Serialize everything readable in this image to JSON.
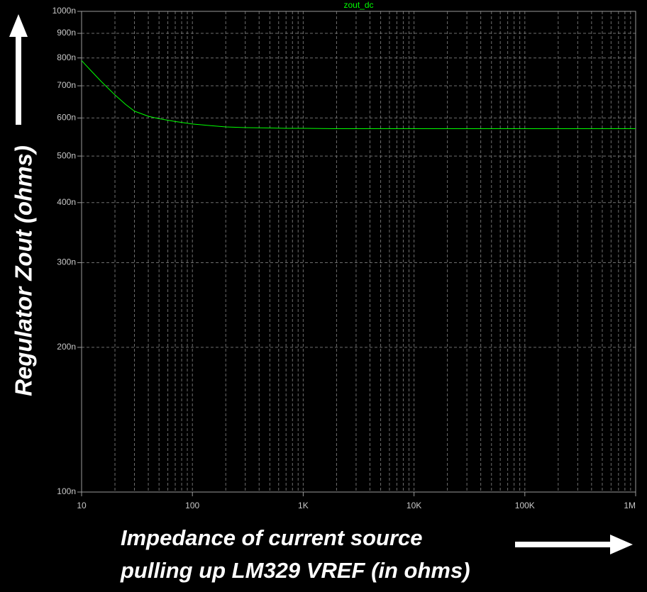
{
  "chart_data": {
    "type": "line",
    "title": "",
    "xlabel": [
      "Impedance of current source",
      "pulling up LM329 VREF  (in ohms)"
    ],
    "ylabel": "Regulator Zout (ohms)",
    "xscale": "log",
    "yscale": "log",
    "xlim": [
      10,
      1000000
    ],
    "ylim": [
      0.0001,
      0.001
    ],
    "grid": true,
    "legend_position": "top-center",
    "x_ticks": [
      {
        "value": 10,
        "label": "10"
      },
      {
        "value": 100,
        "label": "100"
      },
      {
        "value": 1000,
        "label": "1K"
      },
      {
        "value": 10000,
        "label": "10K"
      },
      {
        "value": 100000,
        "label": "100K"
      },
      {
        "value": 1000000,
        "label": "1M"
      }
    ],
    "y_ticks": [
      {
        "value": 0.0001,
        "label": "100n"
      },
      {
        "value": 0.0002,
        "label": "200n"
      },
      {
        "value": 0.0003,
        "label": "300n"
      },
      {
        "value": 0.0004,
        "label": "400n"
      },
      {
        "value": 0.0005,
        "label": "500n"
      },
      {
        "value": 0.0006,
        "label": "600n"
      },
      {
        "value": 0.0007,
        "label": "700n"
      },
      {
        "value": 0.0008,
        "label": "800n"
      },
      {
        "value": 0.0009,
        "label": "900n"
      },
      {
        "value": 0.001,
        "label": "1000n"
      }
    ],
    "series": [
      {
        "name": "zout_dc",
        "color": "#00ff00",
        "x": [
          10,
          12,
          15,
          20,
          25,
          30,
          40,
          50,
          70,
          100,
          150,
          200,
          300,
          500,
          700,
          1000,
          2000,
          5000,
          10000,
          100000,
          1000000
        ],
        "y": [
          0.00079,
          0.000755,
          0.000715,
          0.00067,
          0.00064,
          0.00062,
          0.000605,
          0.000598,
          0.00059,
          0.000583,
          0.000578,
          0.000575,
          0.000573,
          0.000572,
          0.000571,
          0.000571,
          0.00057,
          0.00057,
          0.00057,
          0.00057,
          0.00057
        ]
      }
    ]
  },
  "arrow_color": "#ffffff"
}
